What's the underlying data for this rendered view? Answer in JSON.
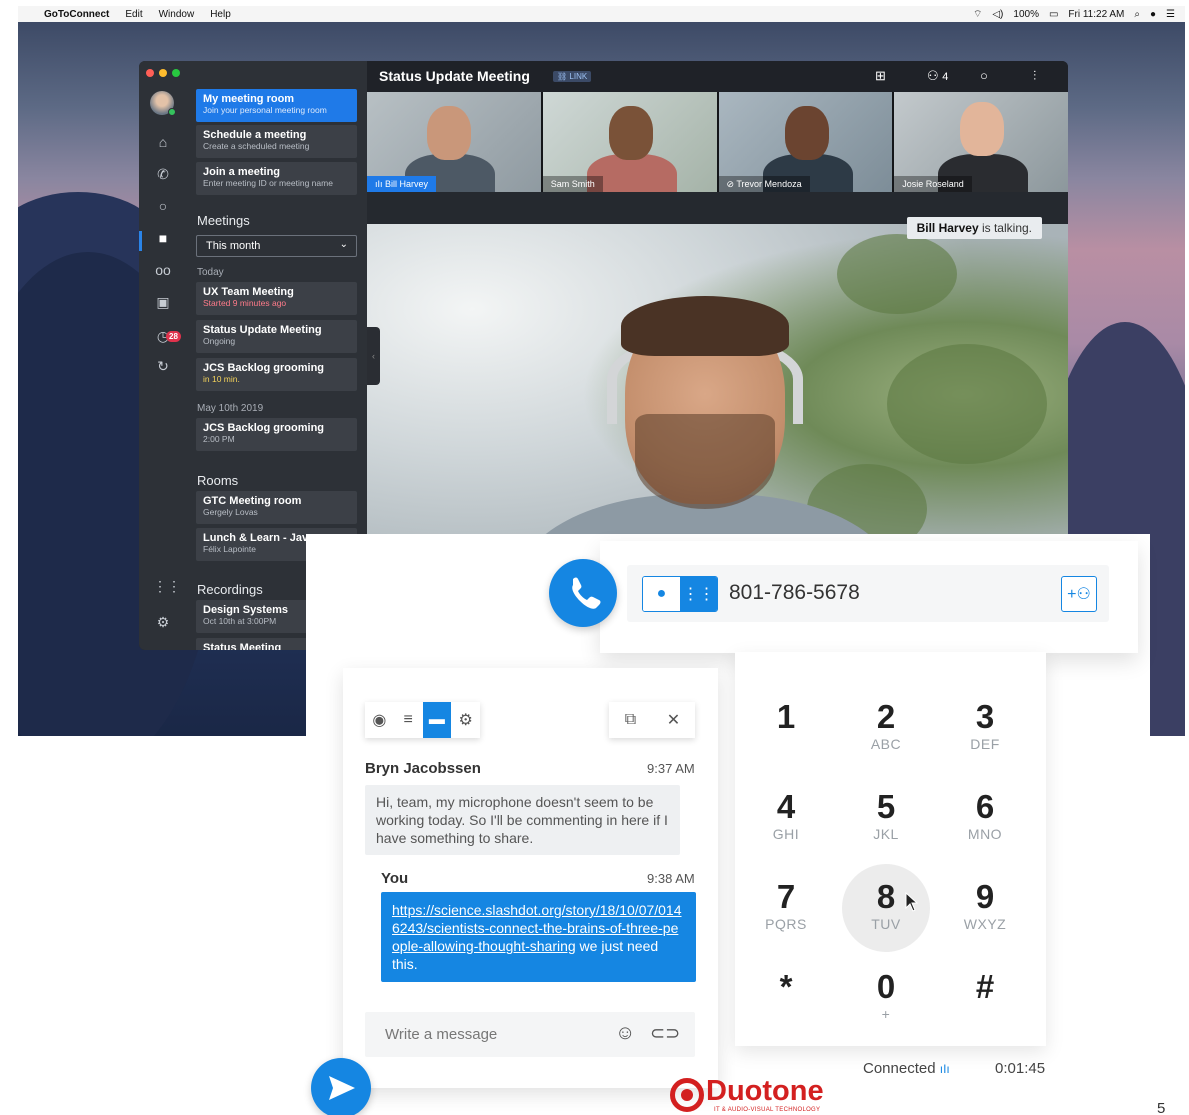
{
  "menubar": {
    "app": "GoToConnect",
    "items": [
      "Edit",
      "Window",
      "Help"
    ],
    "battery": "100%",
    "clock": "Fri 11:22 AM"
  },
  "window": {
    "title": "Status Update Meeting",
    "link_badge": "LINK",
    "participants_count": "4"
  },
  "rail": {
    "badge": "28"
  },
  "sidebar": {
    "quick": [
      {
        "title": "My meeting room",
        "sub": "Join your personal meeting room"
      },
      {
        "title": "Schedule a meeting",
        "sub": "Create a scheduled meeting"
      },
      {
        "title": "Join a meeting",
        "sub": "Enter meeting ID or meeting name"
      }
    ],
    "meetings_heading": "Meetings",
    "filter": "This month",
    "today_label": "Today",
    "today": [
      {
        "title": "UX Team Meeting",
        "sub": "Started 9 minutes ago"
      },
      {
        "title": "Status Update Meeting",
        "sub": "Ongoing"
      },
      {
        "title": "JCS Backlog grooming",
        "sub": "in 10 min."
      }
    ],
    "date_label": "May 10th 2019",
    "dated": [
      {
        "title": "JCS Backlog grooming",
        "sub": "2:00 PM"
      }
    ],
    "rooms_heading": "Rooms",
    "rooms": [
      {
        "title": "GTC Meeting room",
        "sub": "Gergely Lovas"
      },
      {
        "title": "Lunch & Learn - Jav",
        "sub": "Félix Lapointe"
      }
    ],
    "recordings_heading": "Recordings",
    "recordings": [
      {
        "title": "Design Systems",
        "sub": "Oct 10th at 3:00PM"
      },
      {
        "title": "Status Meeting",
        "sub": ""
      }
    ]
  },
  "participants": [
    "Bill Harvey",
    "Sam Smith",
    "Trevor Mendoza",
    "Josie Roseland"
  ],
  "talking": {
    "name": "Bill Harvey",
    "text": " is talking."
  },
  "dialer": {
    "number": "801-786-5678",
    "status": "Connected",
    "timer": "0:01:45",
    "keys": [
      [
        "1",
        ""
      ],
      [
        "2",
        "ABC"
      ],
      [
        "3",
        "DEF"
      ],
      [
        "4",
        "GHI"
      ],
      [
        "5",
        "JKL"
      ],
      [
        "6",
        "MNO"
      ],
      [
        "7",
        "PQRS"
      ],
      [
        "8",
        "TUV"
      ],
      [
        "9",
        "WXYZ"
      ],
      [
        "*",
        ""
      ],
      [
        "0",
        "+"
      ],
      [
        "#",
        ""
      ]
    ]
  },
  "chat": {
    "msg1": {
      "sender": "Bryn Jacobssen",
      "time": "9:37 AM",
      "text": "Hi, team, my microphone doesn't seem to be working today. So I'll be commenting in here if I have something to share."
    },
    "msg2": {
      "sender": "You",
      "time": "9:38 AM",
      "link": "https://science.slashdot.org/story/18/10/07/0146243/scientists-connect-the-brains-of-three-people-allowing-thought-sharing",
      "tail": " we just need this."
    },
    "placeholder": "Write a message"
  },
  "logo": {
    "name": "Duotone",
    "tagline": "IT & AUDIO-VISUAL TECHNOLOGY"
  },
  "page_number": "5",
  "colors": {
    "accent": "#1586e2",
    "brand": "#d32020",
    "sidebar": "#2d3137"
  }
}
